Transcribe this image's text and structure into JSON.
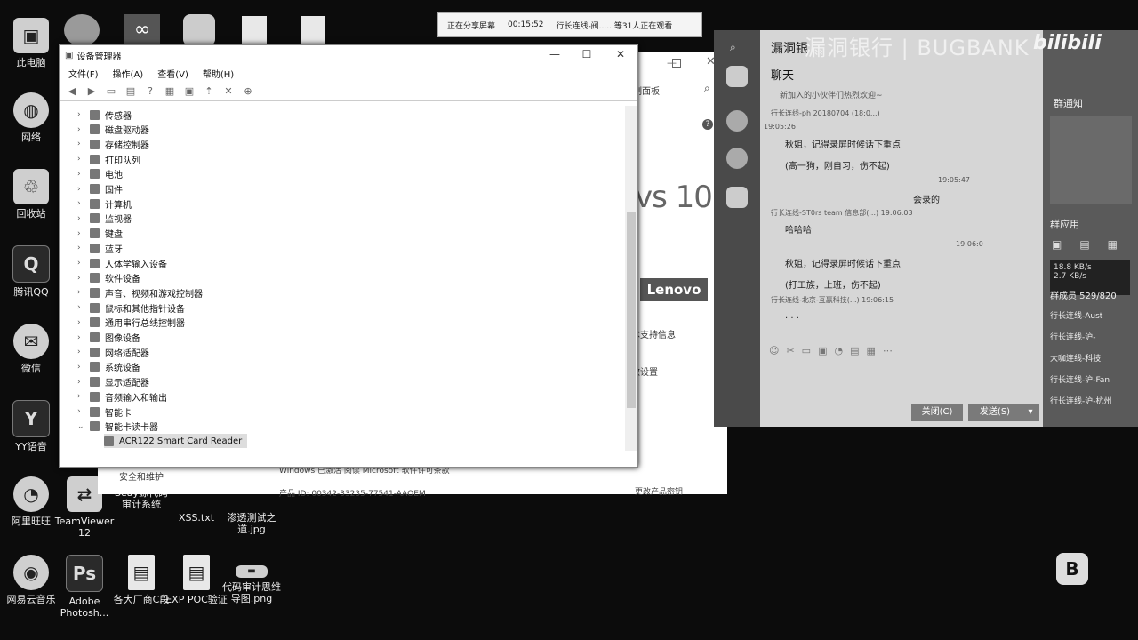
{
  "desktop": {
    "icons": [
      {
        "label": "此电脑",
        "glyph": "▣"
      },
      {
        "label": "网络",
        "glyph": "◍"
      },
      {
        "label": "回收站",
        "glyph": "♲"
      },
      {
        "label": "腾讯QQ",
        "glyph": "Q"
      },
      {
        "label": "微信",
        "glyph": "✉"
      },
      {
        "label": "YY语音",
        "glyph": "Y"
      },
      {
        "label": "阿里旺旺",
        "glyph": "◔"
      },
      {
        "label": "网易云音乐",
        "glyph": "◉"
      },
      {
        "label": "TeamViewer 12",
        "glyph": "⇄"
      },
      {
        "label": "Adobe Photosh...",
        "glyph": "Ps"
      },
      {
        "label": "Seay源代码审计系统",
        "glyph": "S"
      },
      {
        "label": "各大厂商C段",
        "glyph": "▤"
      },
      {
        "label": "XSS.txt",
        "glyph": "▤"
      },
      {
        "label": "EXP POC验证",
        "glyph": "▤"
      },
      {
        "label": "渗透测试之道.jpg",
        "glyph": "▤"
      },
      {
        "label": "代码审计思维导图.png",
        "glyph": "▬"
      }
    ]
  },
  "sharebar": {
    "status": "正在分享屏幕",
    "time": "00:15:52",
    "viewers": "行长连线-阀......等31人正在观看"
  },
  "control_panel": {
    "breadcrumb": "制面板",
    "win_text": "vs 10",
    "lenovo": "Lenovo",
    "support": "术支持信息",
    "change": "改设置",
    "security": "安全和维护",
    "activation": "Windows 已激活   阅读 Microsoft 软件许可条款",
    "product_id": "产品 ID: 00342-33235-77541-AAOEM",
    "change_key": "更改产品密钥"
  },
  "device_manager": {
    "title": "设备管理器",
    "menu": [
      "文件(F)",
      "操作(A)",
      "查看(V)",
      "帮助(H)"
    ],
    "items": [
      "传感器",
      "磁盘驱动器",
      "存储控制器",
      "打印队列",
      "电池",
      "固件",
      "计算机",
      "监视器",
      "键盘",
      "蓝牙",
      "人体学输入设备",
      "软件设备",
      "声音、视频和游戏控制器",
      "鼠标和其他指针设备",
      "通用串行总线控制器",
      "图像设备",
      "网络适配器",
      "系统设备",
      "显示适配器",
      "音频输入和输出",
      "智能卡",
      "智能卡读卡器"
    ],
    "child": "ACR122 Smart Card Reader"
  },
  "chat": {
    "brand": "漏洞银行 | BUGBANK",
    "bili": "bilibili",
    "title": "聊天",
    "joined": "新加入的小伙伴们热烈欢迎~",
    "messages": [
      {
        "meta": "行长连线-ph 20180704 (18:0...)",
        "text": ""
      },
      {
        "meta": "19:05:26",
        "text": "秋姐，记得录屏时候话下重点"
      },
      {
        "meta": "",
        "text": "(高一狗，刚自习，伤不起)"
      },
      {
        "meta": "19:05:47",
        "text": "会录的"
      },
      {
        "meta": "行长连线-ST0rs team 信息部(...)  19:06:03",
        "text": "哈哈哈"
      },
      {
        "meta": "19:06:0",
        "text": "秋姐，记得录屏时候话下重点"
      },
      {
        "meta": "",
        "text": "(打工族，上班，伤不起)"
      },
      {
        "meta": "行长连线-北京-互赢科技(...)  19:06:15",
        "text": ". . ."
      }
    ],
    "close_btn": "关闭(C)",
    "send_btn": "发送(S)",
    "notice_title": "群通知",
    "app_title": "群应用",
    "speed_up": "18.8 KB/s",
    "speed_down": "2.7 KB/s",
    "members": "群成员 529/820",
    "member_list": [
      "行长连线-Aust",
      "行长连线-沪-",
      "大咖连线-科技",
      "行长连线-沪-Fan",
      "行长连线-沪-杭州"
    ]
  },
  "taskbar": {
    "logo": "B"
  }
}
